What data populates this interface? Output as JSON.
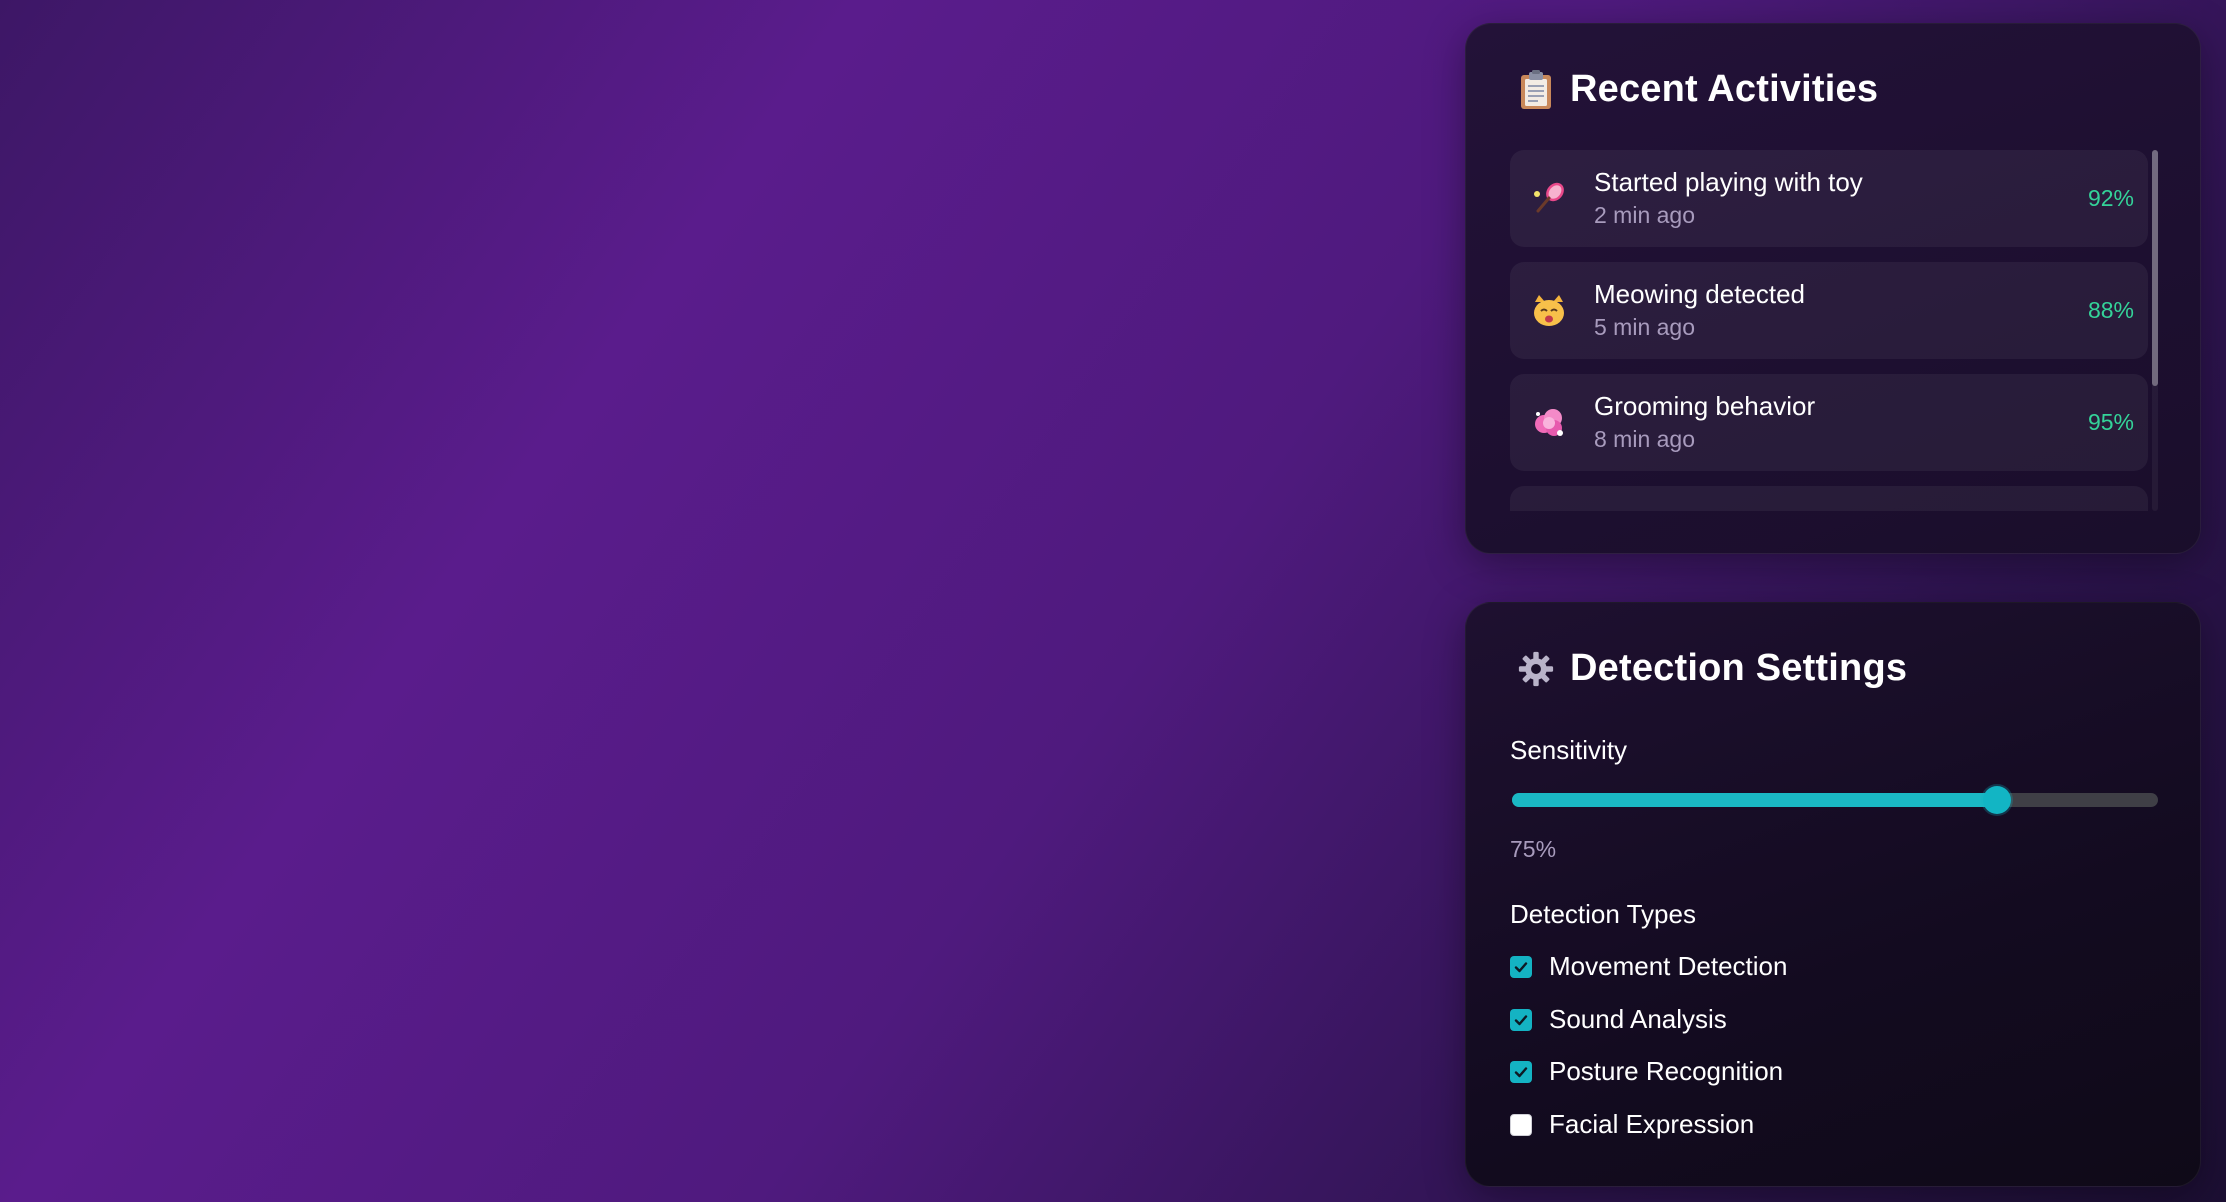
{
  "activities_panel": {
    "title": "Recent Activities",
    "icon": "clipboard-icon",
    "items": [
      {
        "icon": "badminton-racket-icon",
        "title": "Started playing with toy",
        "time": "2 min ago",
        "confidence": "92%"
      },
      {
        "icon": "cat-face-icon",
        "title": "Meowing detected",
        "time": "5 min ago",
        "confidence": "88%"
      },
      {
        "icon": "pink-bubble-icon",
        "title": "Grooming behavior",
        "time": "8 min ago",
        "confidence": "95%"
      }
    ]
  },
  "settings_panel": {
    "title": "Detection Settings",
    "icon": "gear-icon",
    "sensitivity": {
      "label": "Sensitivity",
      "value": 75,
      "value_text": "75%"
    },
    "detection_types": {
      "label": "Detection Types",
      "options": [
        {
          "label": "Movement Detection",
          "checked": true
        },
        {
          "label": "Sound Analysis",
          "checked": true
        },
        {
          "label": "Posture Recognition",
          "checked": true
        },
        {
          "label": "Facial Expression",
          "checked": false
        }
      ]
    }
  },
  "colors": {
    "accent": "#14b3c3",
    "confidence": "#34d399",
    "muted_text": "#a89bbd"
  }
}
